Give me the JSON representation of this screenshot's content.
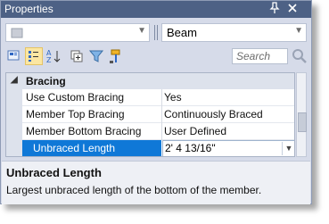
{
  "window": {
    "title": "Properties",
    "pin_icon": "pin-icon",
    "close_icon": "close-icon"
  },
  "selector": {
    "left_combo_value": "",
    "right_combo_value": "Beam"
  },
  "toolbar": {
    "icons": [
      "categorized-view-icon",
      "property-pages-icon",
      "alphabetical-sort-icon",
      "expand-icon",
      "filter-icon",
      "paint-icon"
    ],
    "search_placeholder": "Search"
  },
  "grid": {
    "category": "Bracing",
    "rows": [
      {
        "name": "Use Custom Bracing",
        "value": "Yes"
      },
      {
        "name": "Member Top Bracing",
        "value": "Continuously Braced"
      },
      {
        "name": "Member Bottom Bracing",
        "value": "User Defined"
      },
      {
        "name": "Unbraced Length",
        "value": "2' 4 13/16\""
      }
    ]
  },
  "description": {
    "title": "Unbraced Length",
    "text": "Largest unbraced length of the bottom of the member."
  }
}
